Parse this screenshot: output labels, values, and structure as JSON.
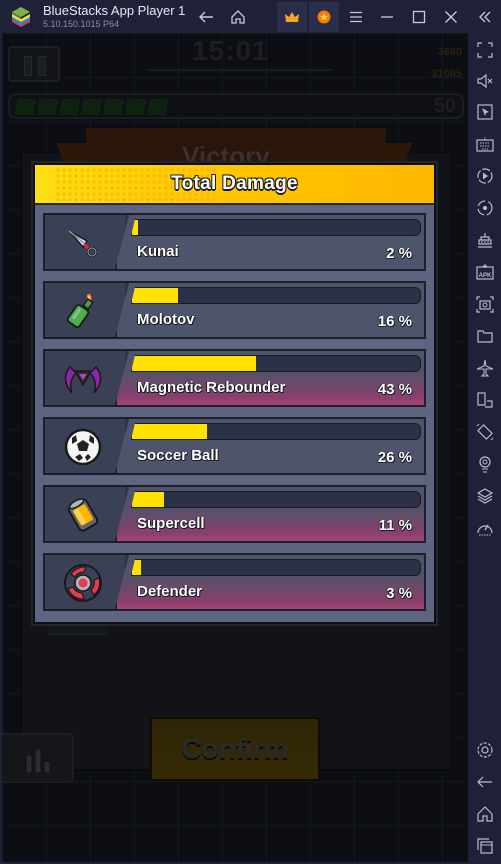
{
  "window": {
    "title": "BlueStacks App Player 1",
    "version": "5.10.150.1015  P64"
  },
  "titlebar_buttons": [
    {
      "name": "back-icon"
    },
    {
      "name": "home-icon"
    },
    {
      "name": "crown-icon"
    },
    {
      "name": "coin-badge-icon"
    },
    {
      "name": "menu-icon"
    },
    {
      "name": "minimize-icon"
    },
    {
      "name": "maximize-icon"
    },
    {
      "name": "close-icon"
    },
    {
      "name": "collapse-sidebar-icon"
    }
  ],
  "sidebar": {
    "items": [
      {
        "name": "fullscreen-icon"
      },
      {
        "name": "volume-mute-icon"
      },
      {
        "name": "pointer-icon"
      },
      {
        "name": "keyboard-icon"
      },
      {
        "name": "record-icon"
      },
      {
        "name": "rotate-sync-icon"
      },
      {
        "name": "performance-icon"
      },
      {
        "name": "apk-install-icon",
        "label": "APK"
      },
      {
        "name": "screenshot-icon"
      },
      {
        "name": "folder-icon"
      },
      {
        "name": "airplane-mode-icon"
      },
      {
        "name": "multi-instance-icon"
      },
      {
        "name": "shake-icon"
      },
      {
        "name": "location-icon"
      },
      {
        "name": "layers-icon"
      },
      {
        "name": "eco-mode-icon"
      },
      {
        "name": "settings-icon"
      },
      {
        "name": "android-back-icon"
      },
      {
        "name": "android-home-icon"
      },
      {
        "name": "recent-apps-icon"
      }
    ]
  },
  "game": {
    "timer": "15:01",
    "coins": "3680",
    "kills": "31065",
    "level": "50",
    "victory_label": "Victory",
    "confirm_label": "Confirm",
    "colors": {
      "accent_yellow": "#ffe000",
      "header_yellow": "#ffc400",
      "panel_bg": "#5d6580",
      "row_pink": "#a34576"
    }
  },
  "modal": {
    "title": "Total Damage",
    "rows": [
      {
        "name": "Kunai",
        "percent": 2,
        "percent_label": "2 %",
        "icon": "kunai-icon",
        "highlight": false
      },
      {
        "name": "Molotov",
        "percent": 16,
        "percent_label": "16 %",
        "icon": "molotov-icon",
        "highlight": false
      },
      {
        "name": "Magnetic Rebounder",
        "percent": 43,
        "percent_label": "43 %",
        "icon": "magnetic-rebounder-icon",
        "highlight": true
      },
      {
        "name": "Soccer Ball",
        "percent": 26,
        "percent_label": "26 %",
        "icon": "soccer-ball-icon",
        "highlight": false
      },
      {
        "name": "Supercell",
        "percent": 11,
        "percent_label": "11 %",
        "icon": "supercell-icon",
        "highlight": true
      },
      {
        "name": "Defender",
        "percent": 3,
        "percent_label": "3 %",
        "icon": "defender-icon",
        "highlight": true
      }
    ]
  }
}
